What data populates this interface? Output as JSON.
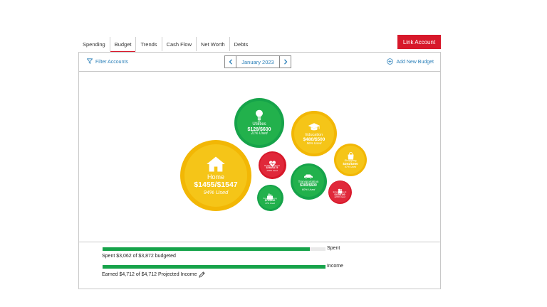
{
  "tabs": [
    "Spending",
    "Budget",
    "Trends",
    "Cash Flow",
    "Net Worth",
    "Debts"
  ],
  "active_tab": "Budget",
  "link_account_label": "Link Account",
  "toolbar": {
    "filter_label": "Filter Accounts",
    "month": "January 2023",
    "add_budget_label": "Add New Budget"
  },
  "colors": {
    "green": "#16a34a",
    "yellow": "#f2b705",
    "red": "#d7182a",
    "link": "#2a7fb8"
  },
  "bubbles": [
    {
      "name": "Home",
      "amount": "$1455/$1547",
      "used": "94% Used",
      "color": "yellow",
      "icon": "house-icon"
    },
    {
      "name": "Utilities",
      "amount": "$128/$600",
      "used": "21% Used",
      "color": "green",
      "icon": "lightbulb-icon"
    },
    {
      "name": "Education",
      "amount": "$480/$500",
      "used": "96% Used",
      "color": "yellow",
      "icon": "graduation-cap-icon"
    },
    {
      "name": "Health & Fitness",
      "amount": "$268/$175",
      "used": "153% Used",
      "color": "red",
      "icon": "heart-pulse-icon"
    },
    {
      "name": "Shopping",
      "amount": "$291/$300",
      "used": "97% Used",
      "color": "yellow",
      "icon": "shopping-bag-icon"
    },
    {
      "name": "Transportation",
      "amount": "$300/$500",
      "used": "60% Used",
      "color": "green",
      "icon": "car-icon"
    },
    {
      "name": "Food & Dining",
      "amount": "$70/$150",
      "used": "47% Used",
      "color": "green",
      "icon": "food-dining-icon"
    },
    {
      "name": "Entertainment",
      "amount": "$120/$100",
      "used": "120% Used",
      "color": "red",
      "icon": "entertainment-icon"
    }
  ],
  "spent": {
    "label": "Spent",
    "summary": "Spent $3,062 of $3,872 budgeted",
    "fraction": 0.93
  },
  "income": {
    "label": "Income",
    "summary": "Earned $4,712 of $4,712 Projected Income",
    "fraction": 1.0
  }
}
